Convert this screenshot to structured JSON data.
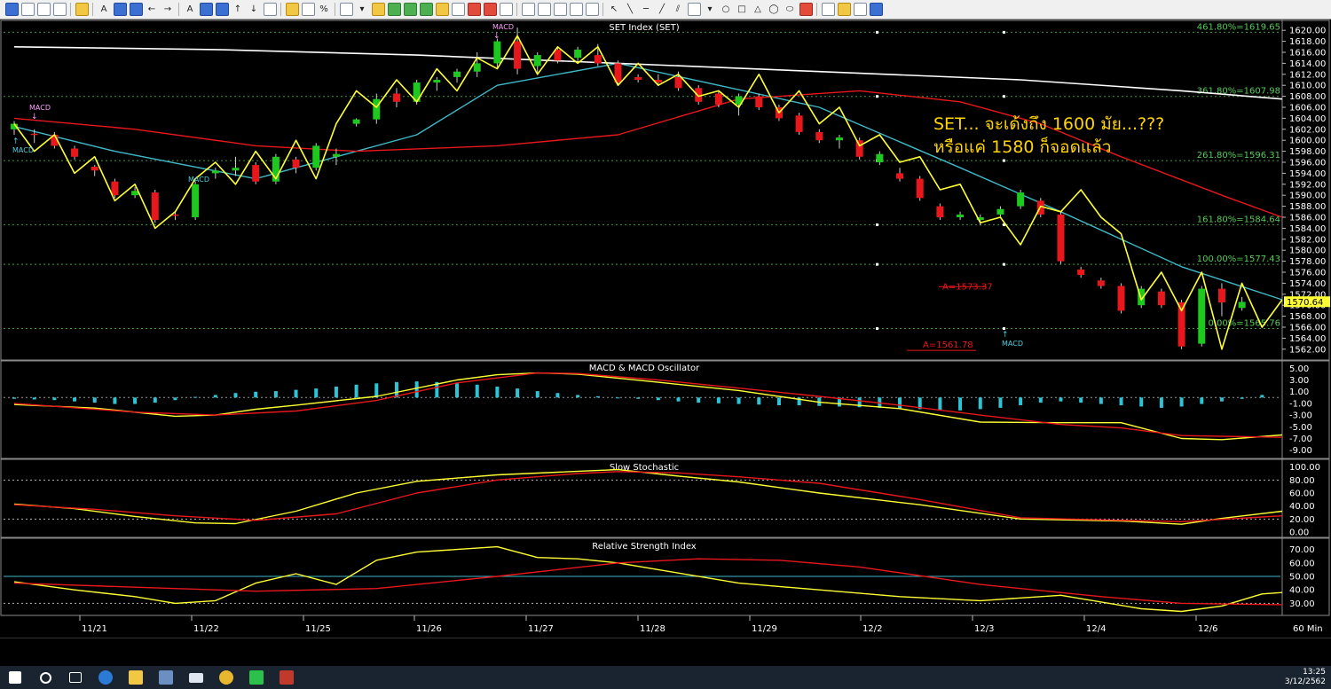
{
  "chart_title": "SET Index (SET)",
  "annotation": {
    "line1": "SET... จะเด้งถึง 1600 มัย...???",
    "line2": "หรือแค่ 1580 ก็จอดแล้ว",
    "color": "#ffd400"
  },
  "fib_levels": [
    {
      "label": "461.80%=1619.65",
      "value": 1619.65
    },
    {
      "label": "361.80%=1607.98",
      "value": 1607.98
    },
    {
      "label": "261.80%=1596.31",
      "value": 1596.31
    },
    {
      "label": "161.80%=1584.64",
      "value": 1584.64
    },
    {
      "label": "100.00%=1577.43",
      "value": 1577.43
    },
    {
      "label": "0.00%=1565.76",
      "value": 1565.76
    }
  ],
  "markers": {
    "a_high": "A=1573.37",
    "a_low": "A=1561.78",
    "last_price": "1570.64",
    "macd": "MACD"
  },
  "price_axis": [
    "1620.00",
    "1618.00",
    "1616.00",
    "1614.00",
    "1612.00",
    "1610.00",
    "1608.00",
    "1606.00",
    "1604.00",
    "1602.00",
    "1600.00",
    "1598.00",
    "1596.00",
    "1594.00",
    "1592.00",
    "1590.00",
    "1588.00",
    "1586.00",
    "1584.00",
    "1582.00",
    "1580.00",
    "1578.00",
    "1576.00",
    "1574.00",
    "1572.00",
    "1570.00",
    "1568.00",
    "1566.00",
    "1564.00",
    "1562.00"
  ],
  "panels": {
    "macd": {
      "title": "MACD & MACD Oscillator",
      "ticks": [
        "5.00",
        "3.00",
        "1.00",
        "-1.00",
        "-3.00",
        "-5.00",
        "-7.00",
        "-9.00"
      ]
    },
    "stoch": {
      "title": "Slow Stochastic",
      "ticks": [
        "100.00",
        "80.00",
        "60.00",
        "40.00",
        "20.00",
        "0.00"
      ]
    },
    "rsi": {
      "title": "Relative Strength Index",
      "ticks": [
        "70.00",
        "60.00",
        "50.00",
        "40.00",
        "30.00"
      ]
    }
  },
  "x_axis": [
    "11/21",
    "11/22",
    "11/25",
    "11/26",
    "11/27",
    "11/28",
    "11/29",
    "12/2",
    "12/3",
    "12/4",
    "12/6"
  ],
  "interval": "60 Min",
  "clock": {
    "time": "13:25",
    "date": "3/12/2562"
  },
  "colors": {
    "up": "#1ec81e",
    "down": "#e8171b",
    "zigzag": "#ffff33",
    "ma_short": "#3fb8c8",
    "ma_mid": "#e8171b",
    "ma_long": "#ffffff",
    "fib": "#55cc55",
    "grid": "#2a6a2a"
  },
  "chart_data": [
    {
      "type": "candlestick",
      "title": "SET Index (SET)",
      "ylim": [
        1561,
        1621
      ],
      "candles": [
        [
          1602.0,
          1603.5,
          1601.0,
          1603.0
        ],
        [
          1601.2,
          1602.0,
          1599.5,
          1601.0
        ],
        [
          1601.0,
          1601.5,
          1598.5,
          1599.0
        ],
        [
          1598.5,
          1599.0,
          1596.5,
          1597.0
        ],
        [
          1595.2,
          1595.5,
          1593.5,
          1594.5
        ],
        [
          1592.5,
          1593.0,
          1589.5,
          1590.0
        ],
        [
          1590.0,
          1591.5,
          1589.5,
          1590.8
        ],
        [
          1590.5,
          1591.0,
          1585.0,
          1585.5
        ],
        [
          1586.5,
          1587.0,
          1585.5,
          1586.3
        ],
        [
          1586.0,
          1592.5,
          1585.5,
          1592.0
        ],
        [
          1594.0,
          1595.0,
          1593.0,
          1594.5
        ],
        [
          1594.5,
          1597.0,
          1593.5,
          1595.0
        ],
        [
          1595.5,
          1596.0,
          1592.0,
          1592.5
        ],
        [
          1592.5,
          1597.5,
          1592.0,
          1597.0
        ],
        [
          1596.5,
          1597.0,
          1594.0,
          1595.0
        ],
        [
          1595.0,
          1599.5,
          1594.5,
          1599.0
        ],
        [
          1597.0,
          1598.5,
          1595.5,
          1597.5
        ],
        [
          1603.0,
          1604.0,
          1602.5,
          1603.8
        ],
        [
          1603.8,
          1608.5,
          1603.0,
          1607.5
        ],
        [
          1608.5,
          1609.5,
          1606.0,
          1607.0
        ],
        [
          1607.0,
          1611.0,
          1606.5,
          1610.5
        ],
        [
          1610.5,
          1611.5,
          1609.0,
          1611.0
        ],
        [
          1611.5,
          1613.0,
          1610.5,
          1612.5
        ],
        [
          1612.5,
          1616.0,
          1611.5,
          1614.0
        ],
        [
          1614.0,
          1618.5,
          1613.0,
          1618.0
        ],
        [
          1618.0,
          1620.5,
          1612.0,
          1613.0
        ],
        [
          1613.5,
          1616.0,
          1612.0,
          1615.5
        ],
        [
          1616.5,
          1617.0,
          1614.0,
          1614.5
        ],
        [
          1615.0,
          1617.0,
          1614.5,
          1616.5
        ],
        [
          1615.5,
          1617.5,
          1613.5,
          1614.0
        ],
        [
          1614.0,
          1614.5,
          1610.0,
          1610.5
        ],
        [
          1611.5,
          1612.0,
          1610.5,
          1611.0
        ],
        [
          1611.0,
          1612.0,
          1610.0,
          1610.5
        ],
        [
          1611.5,
          1612.5,
          1609.0,
          1609.5
        ],
        [
          1609.5,
          1610.0,
          1606.5,
          1607.0
        ],
        [
          1608.5,
          1609.0,
          1606.0,
          1606.5
        ],
        [
          1606.5,
          1608.5,
          1604.5,
          1608.0
        ],
        [
          1608.0,
          1608.5,
          1605.5,
          1606.0
        ],
        [
          1606.0,
          1606.5,
          1603.5,
          1604.0
        ],
        [
          1604.5,
          1605.0,
          1601.0,
          1601.5
        ],
        [
          1601.5,
          1602.0,
          1599.5,
          1600.0
        ],
        [
          1600.0,
          1601.0,
          1598.5,
          1600.5
        ],
        [
          1600.0,
          1600.5,
          1596.5,
          1597.0
        ],
        [
          1596.0,
          1598.0,
          1595.5,
          1597.5
        ],
        [
          1594.0,
          1595.0,
          1592.5,
          1593.0
        ],
        [
          1593.0,
          1593.5,
          1589.0,
          1589.5
        ],
        [
          1588.0,
          1588.5,
          1585.5,
          1586.0
        ],
        [
          1586.0,
          1587.0,
          1585.5,
          1586.5
        ],
        [
          1585.5,
          1586.5,
          1584.5,
          1586.0
        ],
        [
          1586.5,
          1588.0,
          1586.0,
          1587.5
        ],
        [
          1588.0,
          1591.0,
          1587.5,
          1590.5
        ],
        [
          1589.0,
          1589.5,
          1586.0,
          1586.5
        ],
        [
          1586.5,
          1587.0,
          1577.5,
          1578.0
        ],
        [
          1576.5,
          1577.0,
          1575.0,
          1575.5
        ],
        [
          1574.5,
          1575.0,
          1573.0,
          1573.5
        ],
        [
          1573.5,
          1574.0,
          1568.5,
          1569.0
        ],
        [
          1570.0,
          1573.5,
          1569.5,
          1573.0
        ],
        [
          1572.5,
          1573.0,
          1569.5,
          1570.0
        ],
        [
          1570.5,
          1571.0,
          1562.0,
          1562.5
        ],
        [
          1563.0,
          1573.5,
          1562.5,
          1573.0
        ],
        [
          1573.0,
          1574.0,
          1568.0,
          1570.5
        ],
        [
          1569.5,
          1571.5,
          1569.0,
          1570.6
        ]
      ],
      "zigzag": [
        1603,
        1598,
        1601,
        1594,
        1597,
        1589,
        1592,
        1584,
        1587,
        1593,
        1596,
        1592,
        1598,
        1593,
        1600,
        1593,
        1603,
        1609,
        1606,
        1611,
        1607,
        1613,
        1609,
        1615,
        1613,
        1619,
        1612,
        1617,
        1614,
        1617,
        1610,
        1614,
        1610,
        1612,
        1608,
        1609,
        1606,
        1612,
        1605,
        1609,
        1603,
        1606,
        1599,
        1601,
        1596,
        1597,
        1591,
        1592,
        1585,
        1586,
        1581,
        1588,
        1587,
        1591,
        1586,
        1583,
        1571,
        1576,
        1569,
        1576,
        1562,
        1574,
        1566,
        1571
      ],
      "series": [
        {
          "name": "ma_short",
          "x": [
            0,
            5,
            12,
            20,
            24,
            30,
            40,
            47,
            52,
            58,
            63
          ],
          "values": [
            1602.5,
            1598,
            1593,
            1601,
            1610,
            1614,
            1606,
            1595,
            1587,
            1577,
            1571
          ]
        },
        {
          "name": "ma_mid",
          "x": [
            0,
            6,
            12,
            17,
            24,
            30,
            36,
            42,
            47,
            51,
            55,
            60,
            63
          ],
          "values": [
            1604,
            1602,
            1599,
            1598,
            1599,
            1601,
            1607.5,
            1609,
            1607,
            1603,
            1597,
            1590,
            1586
          ]
        },
        {
          "name": "ma_long",
          "x": [
            0,
            10,
            20,
            30,
            40,
            50,
            58,
            63
          ],
          "values": [
            1617,
            1616.5,
            1615.5,
            1614,
            1612.5,
            1611,
            1609,
            1607.5
          ]
        }
      ]
    },
    {
      "type": "bar_line",
      "title": "MACD & MACD Oscillator",
      "ylim": [
        -9.5,
        5.5
      ],
      "oscillator": [
        -0.1,
        -0.15,
        -0.2,
        -0.3,
        -0.4,
        -0.5,
        -0.5,
        -0.4,
        -0.2,
        0.05,
        0.2,
        0.35,
        0.45,
        0.5,
        0.6,
        0.7,
        0.85,
        1.0,
        1.1,
        1.2,
        1.25,
        1.2,
        1.1,
        1.0,
        0.85,
        0.7,
        0.5,
        0.35,
        0.2,
        0.1,
        0,
        -0.1,
        -0.2,
        -0.3,
        -0.4,
        -0.45,
        -0.5,
        -0.55,
        -0.6,
        -0.6,
        -0.65,
        -0.7,
        -0.75,
        -0.8,
        -0.85,
        -0.9,
        -0.95,
        -1.0,
        -0.9,
        -0.8,
        -0.6,
        -0.4,
        -0.3,
        -0.4,
        -0.5,
        -0.6,
        -0.7,
        -0.8,
        -0.7,
        -0.5,
        -0.3,
        -0.1,
        0.2
      ],
      "series": [
        {
          "name": "macd",
          "x": [
            0,
            4,
            8,
            10,
            12,
            14,
            18,
            22,
            24,
            26,
            28,
            32,
            36,
            40,
            44,
            48,
            52,
            55,
            58,
            60,
            63
          ],
          "values": [
            -1.2,
            -1.8,
            -3.2,
            -3.0,
            -2.0,
            -1.3,
            0.2,
            3.0,
            3.9,
            4.2,
            4.0,
            2.6,
            1.2,
            -0.8,
            -1.9,
            -4.2,
            -4.3,
            -4.3,
            -7.0,
            -7.2,
            -6.4
          ]
        },
        {
          "name": "signal",
          "x": [
            0,
            6,
            10,
            14,
            18,
            22,
            26,
            28,
            32,
            36,
            40,
            44,
            48,
            52,
            55,
            58,
            63
          ],
          "values": [
            -1.0,
            -2.5,
            -3.0,
            -2.3,
            -0.5,
            2.5,
            4.2,
            4.1,
            3.0,
            1.6,
            0.2,
            -1.3,
            -3.0,
            -4.6,
            -5.2,
            -6.5,
            -6.8
          ]
        }
      ]
    },
    {
      "type": "line",
      "title": "Slow Stochastic",
      "ylim": [
        0,
        105
      ],
      "series": [
        {
          "name": "k",
          "x": [
            0,
            3,
            6,
            9,
            11,
            14,
            17,
            20,
            24,
            27,
            30,
            33,
            36,
            40,
            45,
            50,
            55,
            58,
            60,
            63
          ],
          "values": [
            43,
            36,
            24,
            14,
            13,
            32,
            60,
            78,
            88,
            92,
            96,
            86,
            77,
            60,
            42,
            20,
            17,
            12,
            21,
            32
          ]
        },
        {
          "name": "d",
          "x": [
            0,
            4,
            8,
            12,
            16,
            20,
            24,
            28,
            30,
            33,
            36,
            40,
            45,
            50,
            55,
            58,
            63
          ],
          "values": [
            42,
            35,
            25,
            18,
            28,
            60,
            80,
            90,
            93,
            91,
            85,
            75,
            50,
            22,
            18,
            16,
            25
          ]
        }
      ]
    },
    {
      "type": "line",
      "title": "Relative Strength Index",
      "ylim": [
        25,
        75
      ],
      "series": [
        {
          "name": "rsi",
          "x": [
            0,
            3,
            6,
            8,
            10,
            12,
            14,
            16,
            18,
            20,
            22,
            24,
            26,
            28,
            30,
            32,
            36,
            40,
            44,
            48,
            52,
            56,
            58,
            60,
            62,
            63
          ],
          "values": [
            46,
            40,
            35,
            30,
            32,
            45,
            52,
            44,
            62,
            68,
            70,
            72,
            64,
            63,
            60,
            55,
            45,
            40,
            35,
            32,
            36,
            26,
            24,
            28,
            37,
            38
          ]
        },
        {
          "name": "avg",
          "x": [
            0,
            6,
            12,
            18,
            24,
            30,
            34,
            38,
            42,
            48,
            54,
            58,
            63
          ],
          "values": [
            45,
            42,
            39,
            41,
            50,
            60,
            63,
            62,
            57,
            44,
            35,
            30,
            29
          ]
        }
      ]
    }
  ]
}
